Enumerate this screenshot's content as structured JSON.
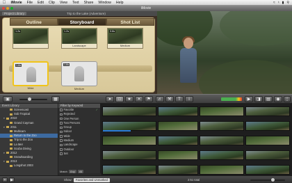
{
  "menubar": {
    "apple": "",
    "items": [
      "iMovie",
      "File",
      "Edit",
      "Clip",
      "View",
      "Text",
      "Share",
      "Window",
      "Help"
    ]
  },
  "window": {
    "title": "iMovie"
  },
  "project": {
    "library_label": "Project Library",
    "name": "Trip to the Lake (Adventure)"
  },
  "storyboard": {
    "tabs": [
      "Outline",
      "Storyboard",
      "Shot List"
    ],
    "active_tab": "Storyboard",
    "top_clips": [
      {
        "duration": "1.2s",
        "caption": ""
      },
      {
        "duration": "1.2s",
        "caption": "Landscape"
      },
      {
        "duration": "3.6s",
        "caption": "Medium"
      }
    ],
    "section_label": "December – 2010",
    "placeholders": [
      {
        "duration": "1.6s",
        "caption": "Wide",
        "selected": true
      },
      {
        "duration": "1.6s",
        "caption": "Medium",
        "selected": false
      }
    ]
  },
  "toolbar": {
    "tool_icons": [
      "arrow-icon",
      "crop-icon",
      "star-icon",
      "reject-icon",
      "keyword-icon",
      "audio-icon",
      "wrench-icon",
      "text-icon",
      "info-icon"
    ]
  },
  "event_library": {
    "header": "Event Library",
    "rows": [
      {
        "label": "Screencast",
        "indent": 2,
        "selected": false
      },
      {
        "label": "Sob Tropical",
        "indent": 2,
        "selected": false
      },
      {
        "label": "2010",
        "indent": 1,
        "selected": false
      },
      {
        "label": "Grand Cayman",
        "indent": 2,
        "selected": false
      },
      {
        "label": "2011",
        "indent": 1,
        "selected": false
      },
      {
        "label": "Multicam",
        "indent": 2,
        "selected": false
      },
      {
        "label": "Return to the Zoo",
        "indent": 2,
        "selected": true
      },
      {
        "label": "Trip to the Zoo",
        "indent": 2,
        "selected": false
      },
      {
        "label": "La Mer",
        "indent": 2,
        "selected": false
      },
      {
        "label": "Scuba Diving",
        "indent": 2,
        "selected": false
      },
      {
        "label": "2012",
        "indent": 1,
        "selected": false
      },
      {
        "label": "Snowboarding",
        "indent": 2,
        "selected": false
      },
      {
        "label": "2013",
        "indent": 1,
        "selected": false
      },
      {
        "label": "Longshot 2003",
        "indent": 2,
        "selected": false
      }
    ]
  },
  "keyword_filter": {
    "header": "Filter by Keyword",
    "keywords": [
      {
        "label": "Favorite",
        "marked": true
      },
      {
        "label": "Rejected",
        "marked": false
      },
      {
        "label": "One Person",
        "marked": false
      },
      {
        "label": "Two Persons",
        "marked": false
      },
      {
        "label": "Group",
        "marked": false
      },
      {
        "label": "Indoor",
        "marked": false
      },
      {
        "label": "Wide",
        "marked": false
      },
      {
        "label": "Medium",
        "marked": false
      },
      {
        "label": "Landscape",
        "marked": false
      },
      {
        "label": "Outdoor",
        "marked": false
      },
      {
        "label": "Set",
        "marked": false
      }
    ],
    "match_label": "Match",
    "match_any": "Any",
    "match_all": "All"
  },
  "footer": {
    "show_label": "Show:",
    "show_value": "Favorites and Unmarked",
    "duration_info": "2:51 total",
    "zoom_label": ""
  },
  "colors": {
    "accent": "#2a7bd8",
    "selection": "#3d6aa0",
    "placeholder_selected": "#f0c419"
  }
}
